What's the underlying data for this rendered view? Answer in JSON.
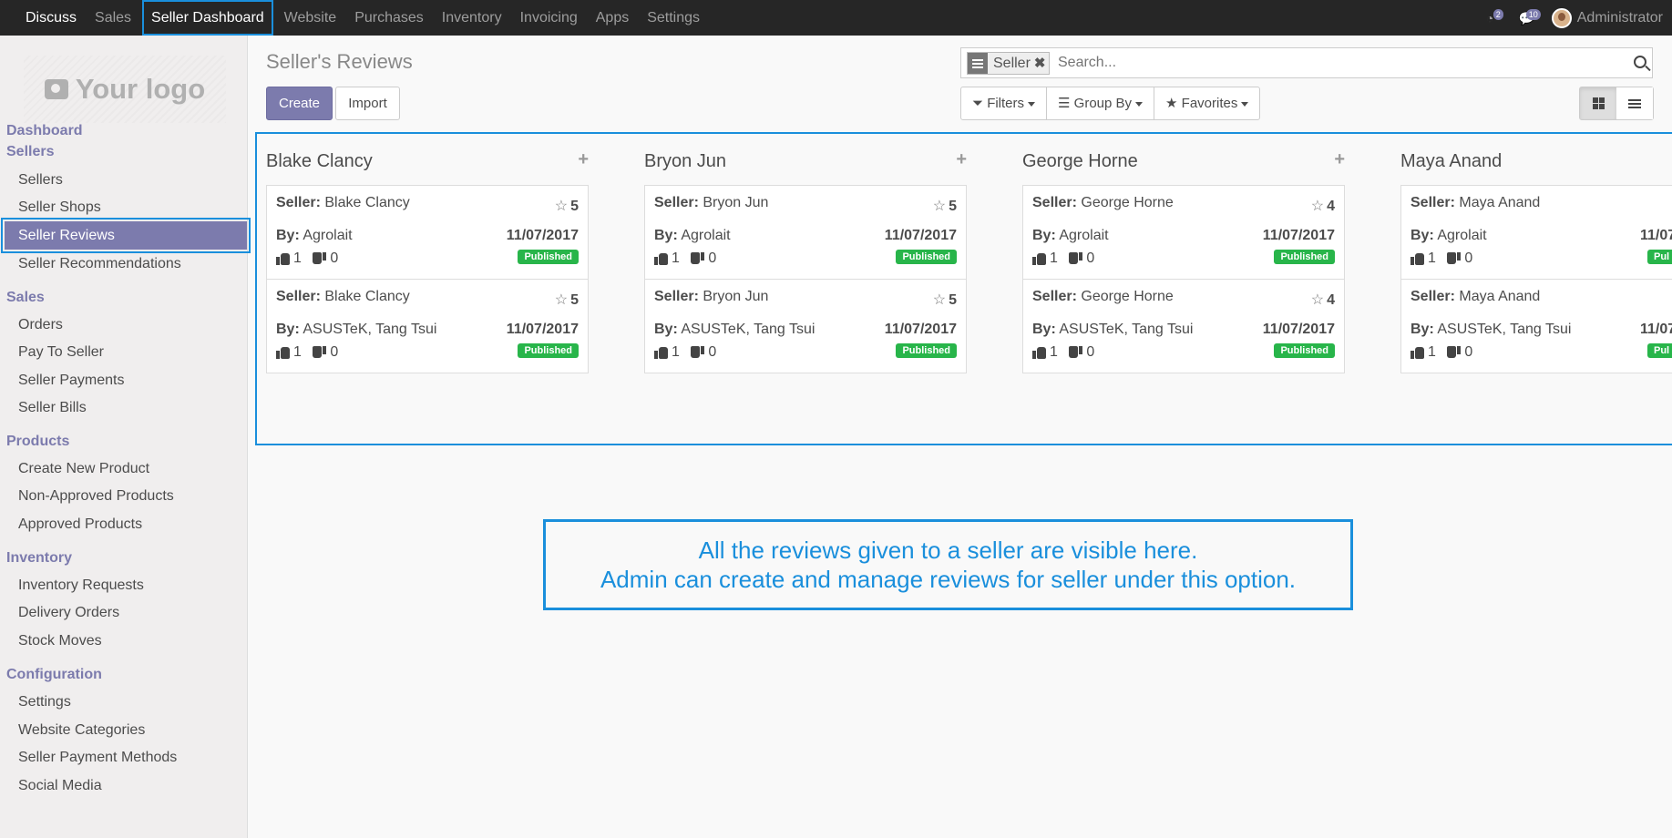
{
  "topnav": {
    "items": [
      "Discuss",
      "Sales",
      "Seller Dashboard",
      "Website",
      "Purchases",
      "Inventory",
      "Invoicing",
      "Apps",
      "Settings"
    ],
    "activity_count": "2",
    "message_count": "10",
    "user_name": "Administrator"
  },
  "sidebar": {
    "logo_text": "Your logo",
    "sections": [
      {
        "title": "Dashboard",
        "items": []
      },
      {
        "title": "Sellers",
        "items": [
          "Sellers",
          "Seller Shops",
          "Seller Reviews",
          "Seller Recommendations"
        ]
      },
      {
        "title": "Sales",
        "items": [
          "Orders",
          "Pay To Seller",
          "Seller Payments",
          "Seller Bills"
        ]
      },
      {
        "title": "Products",
        "items": [
          "Create New Product",
          "Non-Approved Products",
          "Approved Products"
        ]
      },
      {
        "title": "Inventory",
        "items": [
          "Inventory Requests",
          "Delivery Orders",
          "Stock Moves"
        ]
      },
      {
        "title": "Configuration",
        "items": [
          "Settings",
          "Website Categories",
          "Seller Payment Methods",
          "Social Media"
        ]
      }
    ],
    "active_item": "Seller Reviews"
  },
  "control": {
    "title": "Seller's Reviews",
    "create_label": "Create",
    "import_label": "Import",
    "search_facet": "Seller",
    "search_placeholder": "Search...",
    "filters_label": "Filters",
    "groupby_label": "Group By",
    "favorites_label": "Favorites"
  },
  "kanban": {
    "seller_label": "Seller:",
    "by_label": "By:",
    "columns": [
      {
        "title": "Blake Clancy",
        "cards": [
          {
            "seller": "Blake Clancy",
            "rating": "5",
            "by": "Agrolait",
            "date": "11/07/2017",
            "likes": "1",
            "dislikes": "0",
            "status": "Published"
          },
          {
            "seller": "Blake Clancy",
            "rating": "5",
            "by": "ASUSTeK, Tang Tsui",
            "date": "11/07/2017",
            "likes": "1",
            "dislikes": "0",
            "status": "Published"
          }
        ]
      },
      {
        "title": "Bryon Jun",
        "cards": [
          {
            "seller": "Bryon Jun",
            "rating": "5",
            "by": "Agrolait",
            "date": "11/07/2017",
            "likes": "1",
            "dislikes": "0",
            "status": "Published"
          },
          {
            "seller": "Bryon Jun",
            "rating": "5",
            "by": "ASUSTeK, Tang Tsui",
            "date": "11/07/2017",
            "likes": "1",
            "dislikes": "0",
            "status": "Published"
          }
        ]
      },
      {
        "title": "George Horne",
        "cards": [
          {
            "seller": "George Horne",
            "rating": "4",
            "by": "Agrolait",
            "date": "11/07/2017",
            "likes": "1",
            "dislikes": "0",
            "status": "Published"
          },
          {
            "seller": "George Horne",
            "rating": "4",
            "by": "ASUSTeK, Tang Tsui",
            "date": "11/07/2017",
            "likes": "1",
            "dislikes": "0",
            "status": "Published"
          }
        ]
      },
      {
        "title": "Maya Anand",
        "cards": [
          {
            "seller": "Maya Anand",
            "rating": "",
            "by": "Agrolait",
            "date": "11/07",
            "likes": "1",
            "dislikes": "0",
            "status": "Pul"
          },
          {
            "seller": "Maya Anand",
            "rating": "",
            "by": "ASUSTeK, Tang Tsui",
            "date": "11/07",
            "likes": "1",
            "dislikes": "0",
            "status": "Pul"
          }
        ]
      }
    ]
  },
  "callout": {
    "line1": "All the reviews given to a seller are visible here.",
    "line2": "Admin can create and manage reviews for seller under this option."
  },
  "colors": {
    "accent": "#7c7bad",
    "highlight_border": "#1a8fdc",
    "published": "#28b54a",
    "topbar": "#262626"
  }
}
